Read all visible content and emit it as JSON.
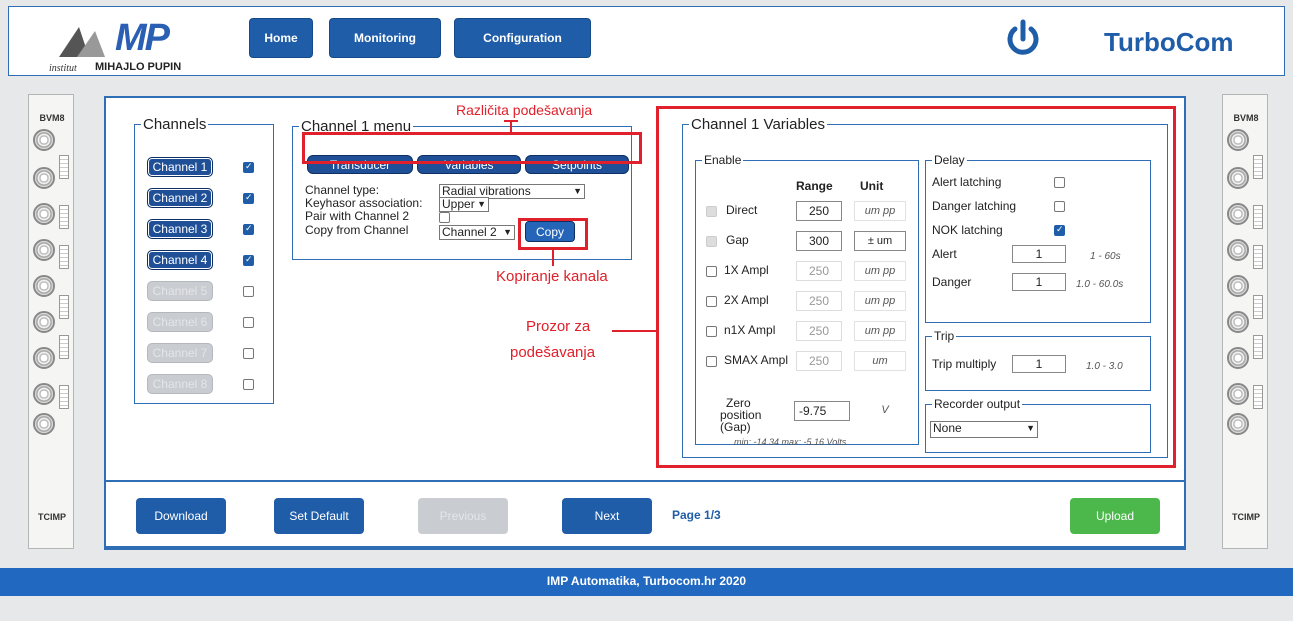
{
  "header": {
    "logo_text": "MP",
    "logo_institute": "institut",
    "logo_org": "MIHAJLO PUPIN",
    "nav": [
      "Home",
      "Monitoring",
      "Configuration"
    ],
    "brand": "TurboCom",
    "power_icon": "power-icon"
  },
  "racks": {
    "top_label": "BVM8",
    "bottom_label": "TCIMP"
  },
  "channels": {
    "legend": "Channels",
    "items": [
      {
        "label": "Channel 1",
        "enabled": true,
        "checked": true
      },
      {
        "label": "Channel 2",
        "enabled": true,
        "checked": true
      },
      {
        "label": "Channel 3",
        "enabled": true,
        "checked": true
      },
      {
        "label": "Channel 4",
        "enabled": true,
        "checked": true
      },
      {
        "label": "Channel 5",
        "enabled": false,
        "checked": false
      },
      {
        "label": "Channel 6",
        "enabled": false,
        "checked": false
      },
      {
        "label": "Channel 7",
        "enabled": false,
        "checked": false
      },
      {
        "label": "Channel 8",
        "enabled": false,
        "checked": false
      }
    ]
  },
  "menu": {
    "legend": "Channel 1 menu",
    "tabs": [
      "Transducer",
      "Variables",
      "Setpoints"
    ],
    "channel_type_label": "Channel type:",
    "channel_type_value": "Radial vibrations",
    "keyhasor_label": "Keyhasor association:",
    "keyhasor_value": "Upper",
    "pair_label": "Pair with Channel 2",
    "copy_label": "Copy from Channel",
    "copy_value": "Channel 2",
    "copy_button": "Copy"
  },
  "annotations": {
    "tabs": "Različita podešavanja",
    "copy": "Kopiranje kanala",
    "window_line1": "Prozor za",
    "window_line2": "podešavanja"
  },
  "variables": {
    "legend": "Channel 1 Variables",
    "enable_legend": "Enable",
    "range_header": "Range",
    "unit_header": "Unit",
    "rows": [
      {
        "label": "Direct",
        "range": "250",
        "unit": "um pp",
        "active": true
      },
      {
        "label": "Gap",
        "range": "300",
        "unit": "± um",
        "active": true
      },
      {
        "label": "1X Ampl",
        "range": "250",
        "unit": "um pp",
        "active": false
      },
      {
        "label": "2X Ampl",
        "range": "250",
        "unit": "um pp",
        "active": false
      },
      {
        "label": "n1X Ampl",
        "range": "250",
        "unit": "um pp",
        "active": false
      },
      {
        "label": "SMAX Ampl",
        "range": "250",
        "unit": "um",
        "active": false
      }
    ],
    "zero_label_1": "Zero",
    "zero_label_2": "position",
    "zero_label_3": "(Gap)",
    "zero_value": "-9.75",
    "zero_unit": "V",
    "zero_hint": "min: -14.34 max: -5.16 Volts",
    "delay_legend": "Delay",
    "alert_latching": "Alert latching",
    "danger_latching": "Danger latching",
    "nok_latching": "NOK latching",
    "alert_label": "Alert",
    "alert_value": "1",
    "alert_hint": "1 - 60s",
    "danger_label": "Danger",
    "danger_value": "1",
    "danger_hint": "1.0 - 60.0s",
    "trip_legend": "Trip",
    "trip_label": "Trip multiply",
    "trip_value": "1",
    "trip_hint": "1.0 - 3.0",
    "recorder_legend": "Recorder output",
    "recorder_value": "None"
  },
  "bottom": {
    "download": "Download",
    "set_default": "Set Default",
    "previous": "Previous",
    "next": "Next",
    "page": "Page 1/3",
    "upload": "Upload"
  },
  "footer": "IMP Automatika, Turbocom.hr 2020",
  "colors": {
    "accent": "#1f5da8",
    "annotation": "#e0202a",
    "upload": "#4cb84c"
  }
}
